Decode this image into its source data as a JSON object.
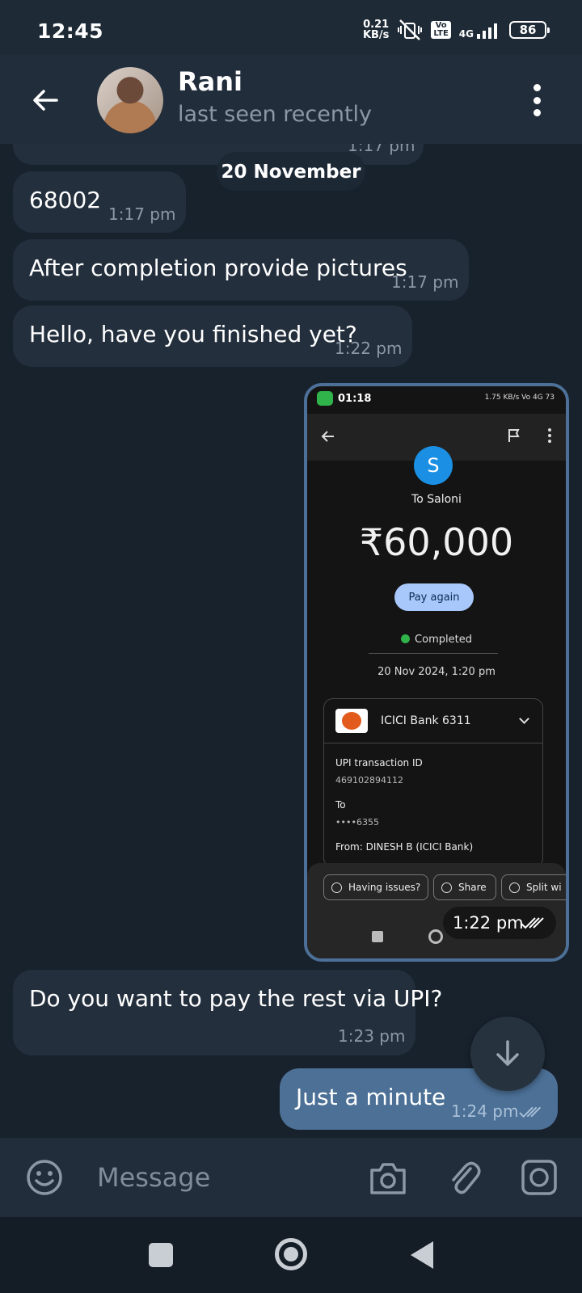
{
  "status_bar": {
    "time": "12:45",
    "speed_value": "0.21",
    "speed_unit": "KB/s",
    "volte": "Vo\nLTE",
    "network": "4G",
    "battery": "86"
  },
  "header": {
    "name": "Rani",
    "status": "last seen recently"
  },
  "chat": {
    "partial_time": "1:17 pm",
    "date_separator": "20 November",
    "messages": [
      {
        "text": "68002",
        "time": "1:17 pm"
      },
      {
        "text": "After completion provide pictures",
        "time": "1:17 pm"
      },
      {
        "text": "Hello, have you finished yet?",
        "time": "1:22 pm"
      },
      {
        "text": "",
        "time": "1:22 pm"
      },
      {
        "text": "Do you want to pay the rest via UPI?",
        "time": "1:23 pm"
      },
      {
        "text": "Just a minute",
        "time": "1:24 pm"
      }
    ]
  },
  "screenshot": {
    "status_time": "01:18",
    "status_right": "1.75 KB/s  Vo 4G  73",
    "avatar_letter": "S",
    "to": "To Saloni",
    "amount": "₹60,000",
    "pay_again": "Pay again",
    "status": "Completed",
    "date": "20 Nov 2024, 1:20 pm",
    "bank": "ICICI Bank 6311",
    "upi_label": "UPI transaction ID",
    "upi_id": "469102894112",
    "to_label": "To",
    "to_value": "••••6355",
    "from": "From: DINESH B (ICICI Bank)",
    "actions": [
      "Having issues?",
      "Share",
      "Split wi"
    ]
  },
  "input": {
    "placeholder": "Message"
  },
  "colors": {
    "background": "#18222d",
    "incoming_bubble": "#232f3d",
    "outgoing_bubble": "#4c7096",
    "header": "#212d3b"
  }
}
